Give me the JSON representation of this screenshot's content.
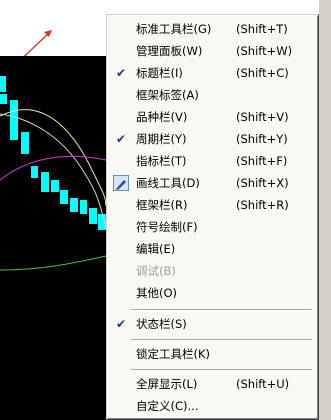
{
  "menu": {
    "items": [
      {
        "label": "标准工具栏(G)",
        "shortcut": "(Shift+T)",
        "checked": false,
        "enabled": true
      },
      {
        "label": "管理面板(W)",
        "shortcut": "(Shift+W)",
        "checked": false,
        "enabled": true
      },
      {
        "label": "标题栏(I)",
        "shortcut": "(Shift+C)",
        "checked": true,
        "enabled": true
      },
      {
        "label": "框架标签(A)",
        "shortcut": "",
        "checked": false,
        "enabled": true
      },
      {
        "label": "品种栏(V)",
        "shortcut": "(Shift+V)",
        "checked": false,
        "enabled": true
      },
      {
        "label": "周期栏(Y)",
        "shortcut": "(Shift+Y)",
        "checked": true,
        "enabled": true
      },
      {
        "label": "指标栏(T)",
        "shortcut": "(Shift+F)",
        "checked": false,
        "enabled": true
      },
      {
        "label": "画线工具(D)",
        "shortcut": "(Shift+X)",
        "checked": true,
        "enabled": true,
        "icon": "pen-icon"
      },
      {
        "label": "框架栏(R)",
        "shortcut": "(Shift+R)",
        "checked": false,
        "enabled": true
      },
      {
        "label": "符号绘制(F)",
        "shortcut": "",
        "checked": false,
        "enabled": true
      },
      {
        "label": "编辑(E)",
        "shortcut": "",
        "checked": false,
        "enabled": true
      },
      {
        "label": "调试(B)",
        "shortcut": "",
        "checked": false,
        "enabled": false
      },
      {
        "label": "其他(O)",
        "shortcut": "",
        "checked": false,
        "enabled": true
      },
      {
        "label": "状态栏(S)",
        "shortcut": "",
        "checked": true,
        "enabled": true
      },
      {
        "label": "锁定工具栏(K)",
        "shortcut": "",
        "checked": false,
        "enabled": true
      },
      {
        "label": "全屏显示(L)",
        "shortcut": "(Shift+U)",
        "checked": false,
        "enabled": true
      },
      {
        "label": "自定义(C)...",
        "shortcut": "",
        "checked": false,
        "enabled": true
      }
    ]
  },
  "colors": {
    "chart_background": "#000000",
    "candle": "#00ffff",
    "arrow": "#e03020",
    "line_yellow": "#e8e8a0",
    "line_green": "#4cbf4c",
    "line_magenta": "#d040d0",
    "line_white": "#d8d8d8"
  }
}
